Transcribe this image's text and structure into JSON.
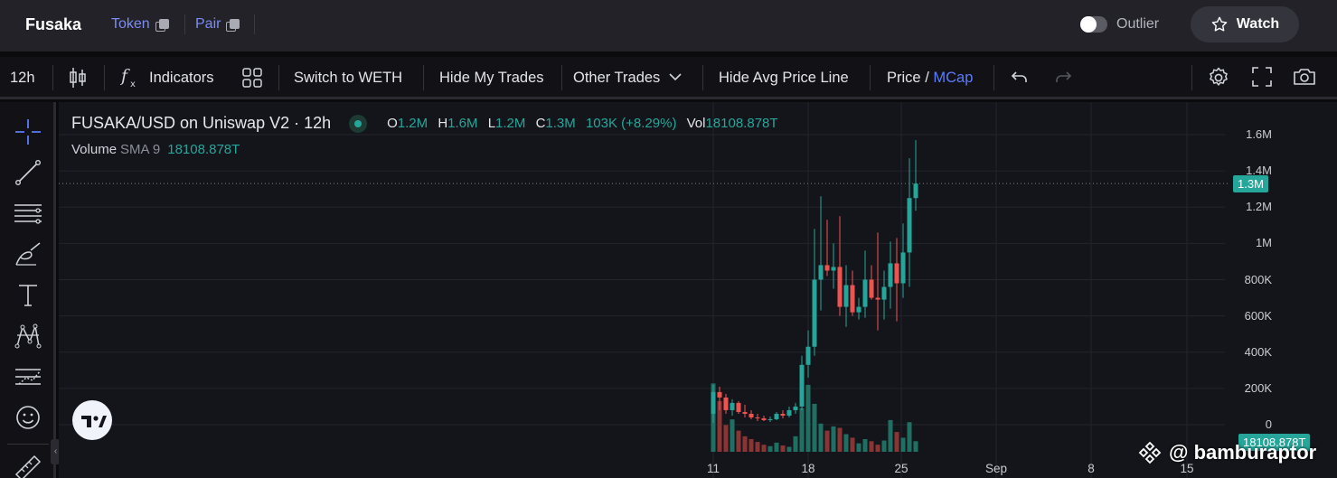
{
  "header": {
    "brand": "Fusaka",
    "token_label": "Token",
    "pair_label": "Pair",
    "outlier_label": "Outlier",
    "outlier_on": false,
    "watch_label": "Watch"
  },
  "toolbar": {
    "interval": "12h",
    "indicators": "Indicators",
    "switch_label": "Switch to WETH",
    "hide_my_trades": "Hide My Trades",
    "other_trades": "Other Trades",
    "hide_avg": "Hide Avg Price Line",
    "price_label": "Price",
    "slash": "/",
    "mcap_label": "MCap"
  },
  "legend": {
    "title": "FUSAKA/USD on Uniswap V2 · 12h",
    "o_label": "O",
    "o_value": "1.2M",
    "h_label": "H",
    "h_value": "1.6M",
    "l_label": "L",
    "l_value": "1.2M",
    "c_label": "C",
    "c_value": "1.3M",
    "change": "103K (+8.29%)",
    "vol_label": "Vol",
    "vol_value": "18108.878T",
    "volume_label": "Volume",
    "sma_label": "SMA 9",
    "sma_value": "18108.878T"
  },
  "watermark": "@ bamburaptor",
  "chart_data": {
    "type": "candlestick",
    "y_ticks": [
      "1.6M",
      "1.4M",
      "1.2M",
      "1M",
      "800K",
      "600K",
      "400K",
      "200K",
      "0"
    ],
    "ylim": [
      0,
      1600000
    ],
    "x_ticks": [
      "11",
      "18",
      "25",
      "Sep",
      "8",
      "15"
    ],
    "last_price_label": "1.3M",
    "last_price": 1330000,
    "volume_label_value": "18108.878T",
    "up_color": "#26a69a",
    "down_color": "#ef5350",
    "candles": [
      {
        "o": 60000,
        "h": 220000,
        "l": 10000,
        "c": 180000,
        "v": 0.97
      },
      {
        "o": 180000,
        "h": 210000,
        "l": 80000,
        "c": 150000,
        "v": 0.72
      },
      {
        "o": 150000,
        "h": 170000,
        "l": 60000,
        "c": 80000,
        "v": 0.38
      },
      {
        "o": 80000,
        "h": 140000,
        "l": 50000,
        "c": 120000,
        "v": 0.46
      },
      {
        "o": 120000,
        "h": 130000,
        "l": 60000,
        "c": 70000,
        "v": 0.3
      },
      {
        "o": 70000,
        "h": 110000,
        "l": 40000,
        "c": 60000,
        "v": 0.22
      },
      {
        "o": 60000,
        "h": 80000,
        "l": 30000,
        "c": 40000,
        "v": 0.18
      },
      {
        "o": 40000,
        "h": 60000,
        "l": 20000,
        "c": 35000,
        "v": 0.14
      },
      {
        "o": 35000,
        "h": 50000,
        "l": 20000,
        "c": 25000,
        "v": 0.1
      },
      {
        "o": 25000,
        "h": 45000,
        "l": 15000,
        "c": 30000,
        "v": 0.08
      },
      {
        "o": 30000,
        "h": 70000,
        "l": 25000,
        "c": 60000,
        "v": 0.13
      },
      {
        "o": 60000,
        "h": 80000,
        "l": 35000,
        "c": 50000,
        "v": 0.09
      },
      {
        "o": 50000,
        "h": 100000,
        "l": 40000,
        "c": 80000,
        "v": 0.07
      },
      {
        "o": 80000,
        "h": 120000,
        "l": 60000,
        "c": 100000,
        "v": 0.22
      },
      {
        "o": 100000,
        "h": 380000,
        "l": 80000,
        "c": 330000,
        "v": 0.62
      },
      {
        "o": 330000,
        "h": 520000,
        "l": 260000,
        "c": 430000,
        "v": 0.95
      },
      {
        "o": 430000,
        "h": 1080000,
        "l": 380000,
        "c": 800000,
        "v": 0.68
      },
      {
        "o": 800000,
        "h": 1260000,
        "l": 630000,
        "c": 880000,
        "v": 0.4
      },
      {
        "o": 880000,
        "h": 1130000,
        "l": 820000,
        "c": 850000,
        "v": 0.3
      },
      {
        "o": 850000,
        "h": 1000000,
        "l": 750000,
        "c": 870000,
        "v": 0.36
      },
      {
        "o": 870000,
        "h": 1150000,
        "l": 600000,
        "c": 650000,
        "v": 0.34
      },
      {
        "o": 650000,
        "h": 880000,
        "l": 540000,
        "c": 770000,
        "v": 0.25
      },
      {
        "o": 770000,
        "h": 850000,
        "l": 600000,
        "c": 620000,
        "v": 0.2
      },
      {
        "o": 620000,
        "h": 700000,
        "l": 580000,
        "c": 650000,
        "v": 0.12
      },
      {
        "o": 650000,
        "h": 960000,
        "l": 590000,
        "c": 800000,
        "v": 0.18
      },
      {
        "o": 800000,
        "h": 880000,
        "l": 690000,
        "c": 700000,
        "v": 0.15
      },
      {
        "o": 700000,
        "h": 1060000,
        "l": 520000,
        "c": 690000,
        "v": 0.1
      },
      {
        "o": 690000,
        "h": 850000,
        "l": 580000,
        "c": 760000,
        "v": 0.16
      },
      {
        "o": 760000,
        "h": 1010000,
        "l": 640000,
        "c": 890000,
        "v": 0.45
      },
      {
        "o": 890000,
        "h": 1030000,
        "l": 570000,
        "c": 780000,
        "v": 0.28
      },
      {
        "o": 780000,
        "h": 1110000,
        "l": 700000,
        "c": 950000,
        "v": 0.2
      },
      {
        "o": 950000,
        "h": 1470000,
        "l": 760000,
        "c": 1250000,
        "v": 0.42
      },
      {
        "o": 1250000,
        "h": 1570000,
        "l": 1180000,
        "c": 1330000,
        "v": 0.15
      }
    ]
  }
}
